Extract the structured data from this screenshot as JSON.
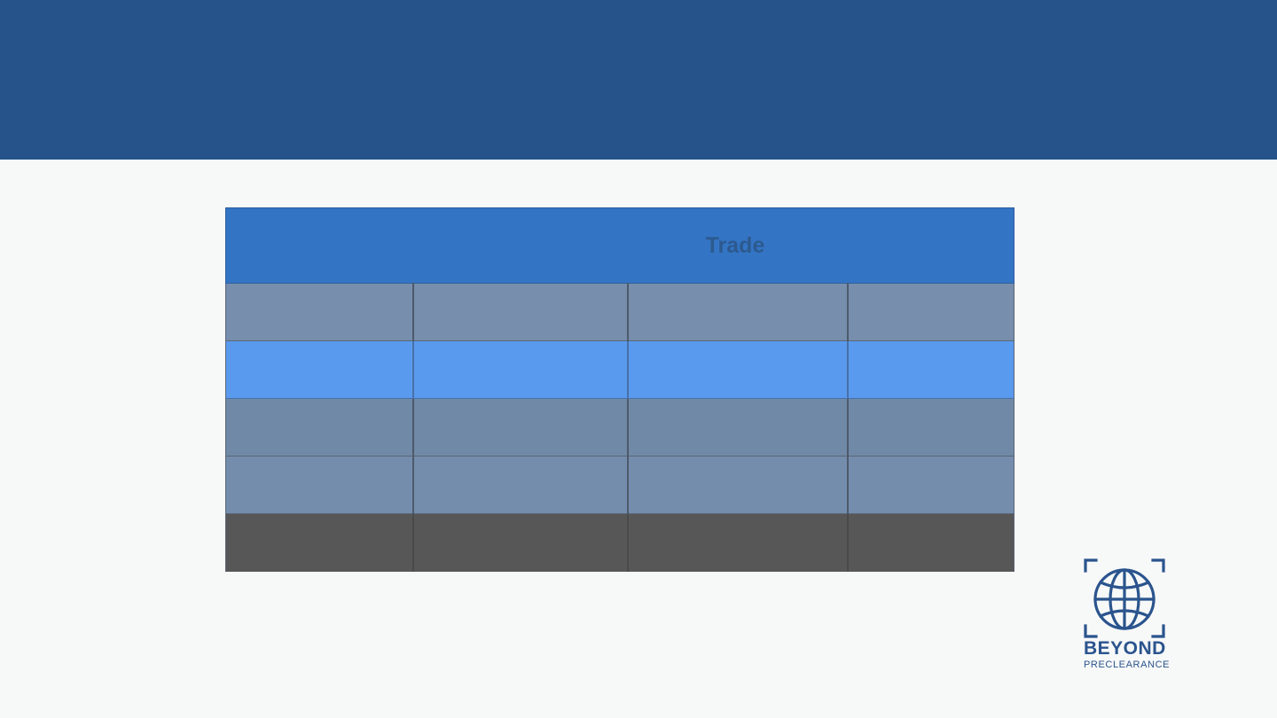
{
  "slide": {
    "table": {
      "header": "Trade",
      "rows": [
        [
          "",
          "",
          "",
          ""
        ],
        [
          "",
          "",
          "",
          ""
        ],
        [
          "",
          "",
          "",
          ""
        ],
        [
          "",
          "",
          "",
          ""
        ],
        [
          "",
          "",
          "",
          ""
        ]
      ]
    },
    "logo": {
      "icon": "globe-in-frame-icon",
      "name_line1": "BEYOND",
      "name_line2": "PRECLEARANCE"
    }
  },
  "colors": {
    "title_band": "#26538a",
    "table_header": "#3474c4",
    "row_slate": "#778ead",
    "row_highlight": "#5a9aee",
    "row_dark": "#575757",
    "logo": "#2a548d"
  }
}
